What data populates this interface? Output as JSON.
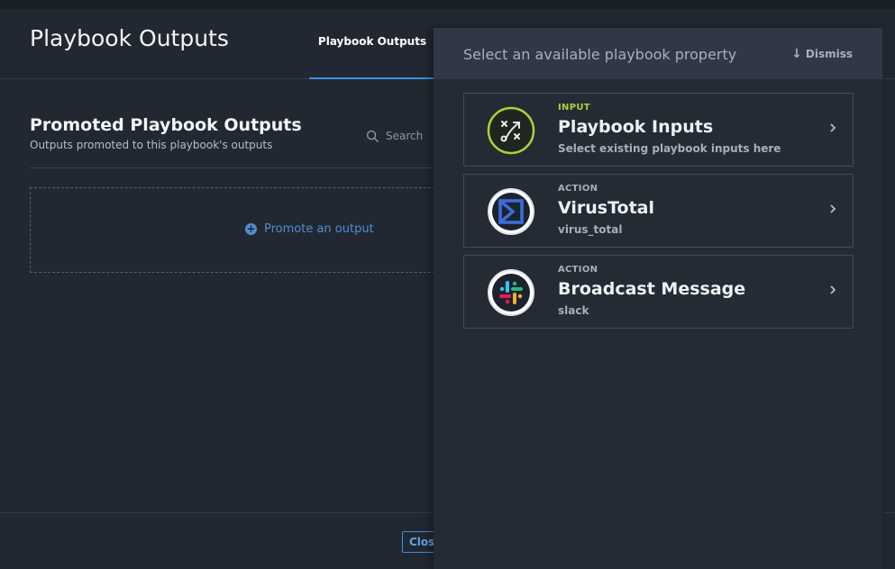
{
  "modal": {
    "title": "Playbook Outputs",
    "tab_label": "Playbook Outputs",
    "section_title": "Promoted Playbook Outputs",
    "section_subtitle": "Outputs promoted to this playbook's outputs",
    "search_placeholder": "Search",
    "promote_label": "Promote an output",
    "close_label": "Close"
  },
  "panel": {
    "title": "Select an available playbook property",
    "dismiss_label": "Dismiss",
    "items": [
      {
        "kind": "INPUT",
        "name": "Playbook Inputs",
        "sub": "Select existing playbook inputs here",
        "icon": "strategy-icon"
      },
      {
        "kind": "ACTION",
        "name": "VirusTotal",
        "sub": "virus_total",
        "icon": "virustotal-icon"
      },
      {
        "kind": "ACTION",
        "name": "Broadcast Message",
        "sub": "slack",
        "icon": "slack-icon"
      }
    ]
  },
  "colors": {
    "accent": "#3b8ee6",
    "input_kind": "#a8d43a",
    "background": "#222831"
  }
}
